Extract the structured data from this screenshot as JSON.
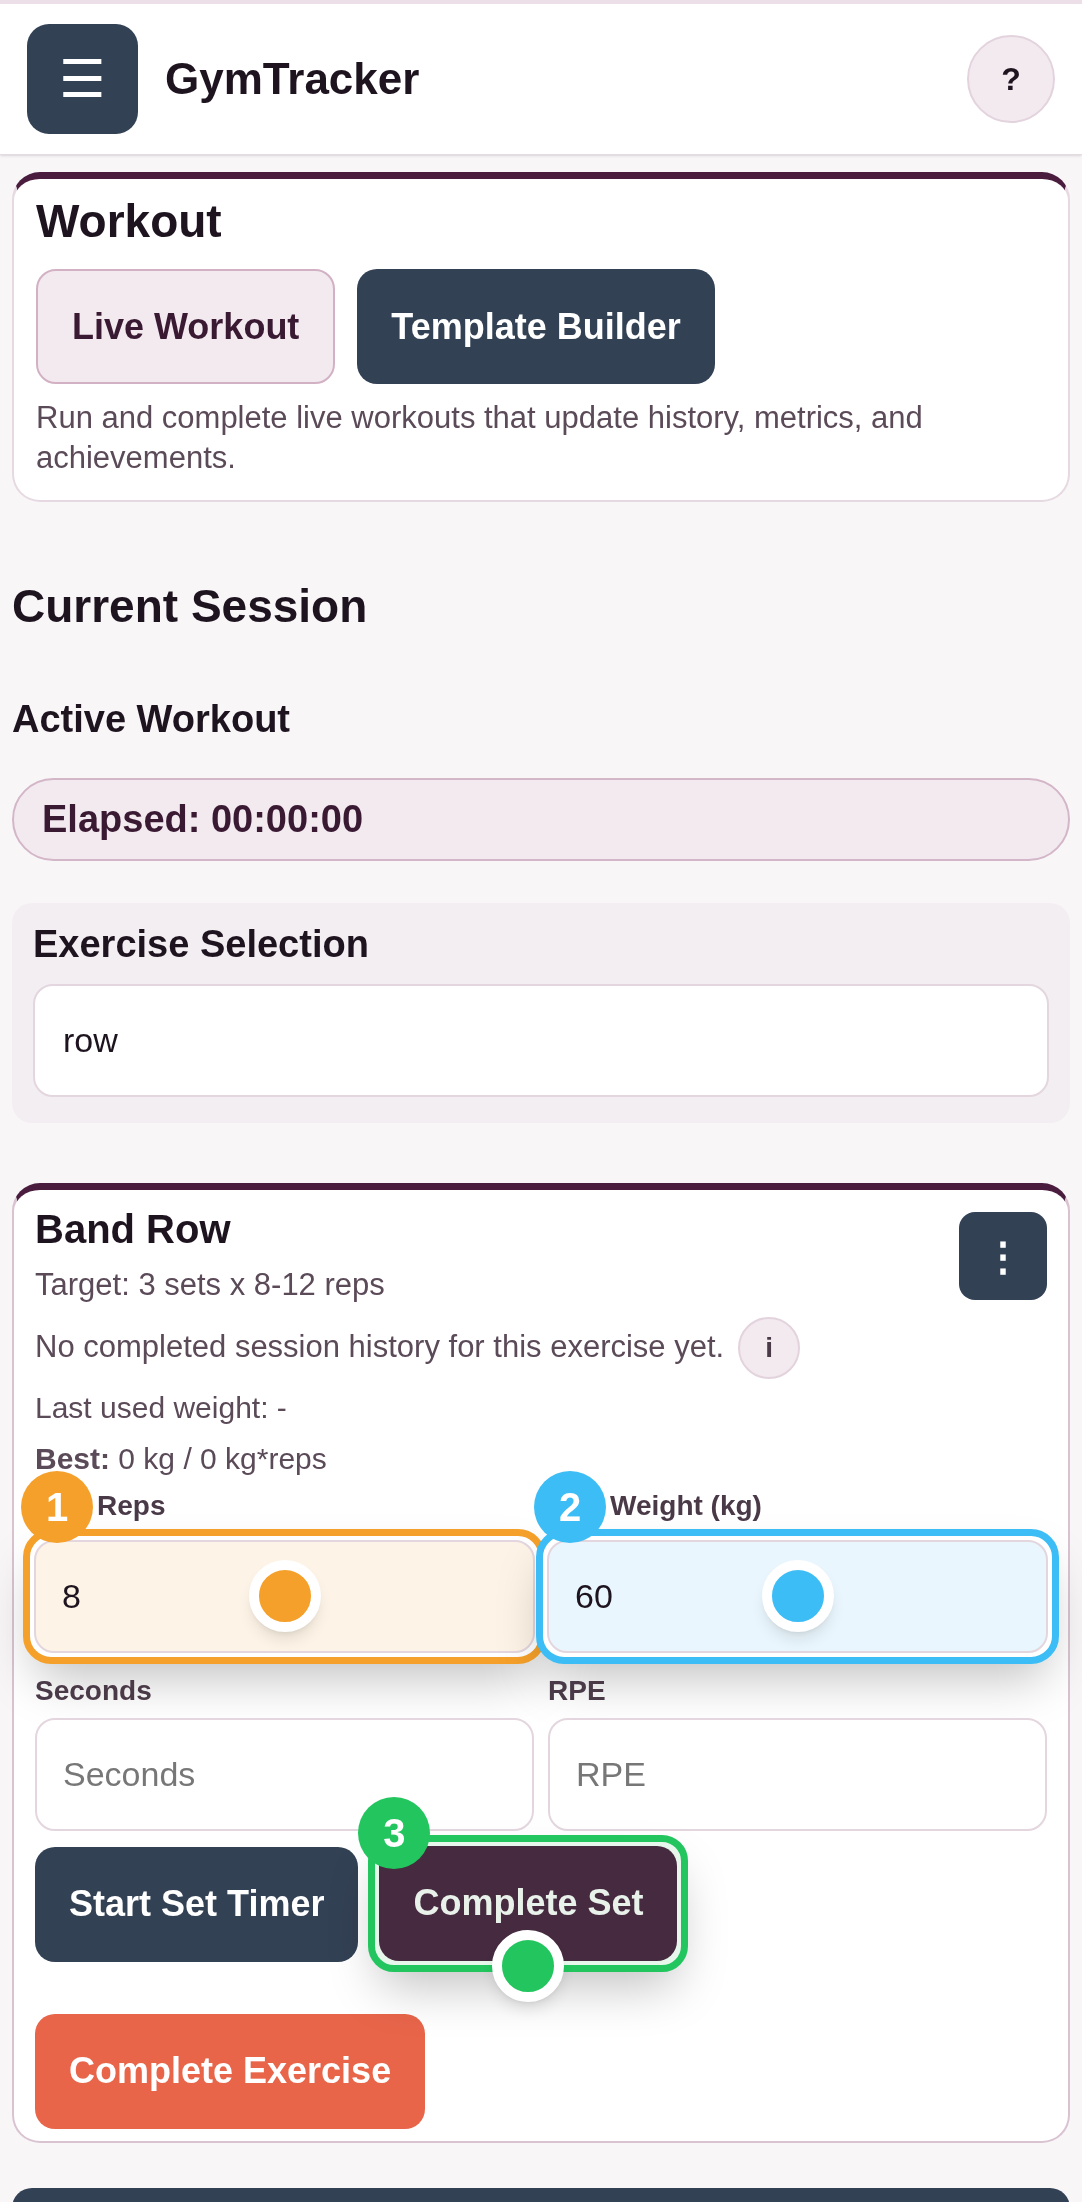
{
  "header": {
    "menu_icon": "☰",
    "title": "GymTracker",
    "help": "?"
  },
  "workout_card": {
    "title": "Workout",
    "modes": [
      {
        "label": "Live Workout",
        "selected": true
      },
      {
        "label": "Template Builder",
        "selected": false
      }
    ],
    "description": "Run and complete live workouts that update history, metrics, and achievements."
  },
  "session": {
    "heading": "Current Session",
    "subheading": "Active Workout",
    "elapsed": "Elapsed: 00:00:00"
  },
  "exercise_selection": {
    "title": "Exercise Selection",
    "value": "row"
  },
  "exercise": {
    "name": "Band Row",
    "menu_icon": "⋮",
    "target": "Target: 3 sets x 8-12 reps",
    "history_note": "No completed session history for this exercise yet.",
    "info_icon": "i",
    "last_used": "Last used weight: -",
    "best": "**Best:** 0 kg / 0 kg*reps",
    "fields": [
      {
        "label": "Reps",
        "value": "8",
        "highlight": {
          "step": "1",
          "color": "#f5a02a"
        }
      },
      {
        "label": "Weight (kg)",
        "value": "60",
        "highlight": {
          "step": "2",
          "color": "#3dbdf5"
        }
      },
      {
        "label": "Seconds",
        "placeholder": "Seconds"
      },
      {
        "label": "RPE",
        "placeholder": "RPE"
      }
    ],
    "buttons": [
      {
        "label": "Start Set Timer",
        "kind": "secondary"
      },
      {
        "label": "Complete Set",
        "kind": "primary",
        "highlight": {
          "step": "3",
          "color": "#22c55e"
        }
      },
      {
        "label": "Complete Exercise",
        "kind": "danger"
      }
    ]
  }
}
